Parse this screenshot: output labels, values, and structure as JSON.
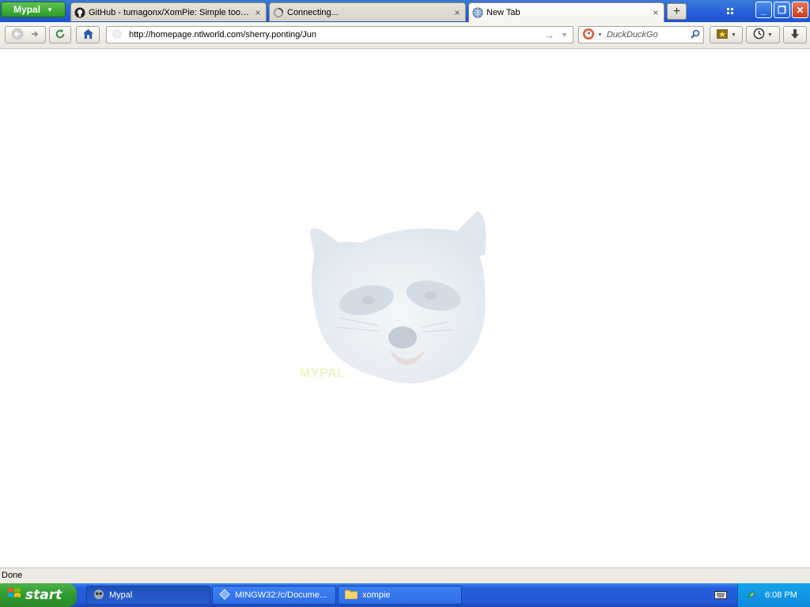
{
  "app_menu": {
    "label": "Mypal"
  },
  "tabs": [
    {
      "title": "GitHub - tumagonx/XomPie: Simple tools t...",
      "favicon": "github-icon",
      "close": "×"
    },
    {
      "title": "Connecting...",
      "favicon": "loading-icon",
      "close": "×"
    },
    {
      "title": "New Tab",
      "favicon": "globe-icon",
      "close": "×",
      "active": true
    }
  ],
  "new_tab": {
    "label": "+"
  },
  "window_controls": {
    "minimize": "_",
    "restore": "❐",
    "close": "✕"
  },
  "navigation": {
    "url": "http://homepage.ntlworld.com/sherry.ponting/Jun",
    "search_placeholder": "DuckDuckGo",
    "search_engine": "duckduckgo-icon"
  },
  "content": {
    "image": "raccoon-face",
    "watermark": "MYPAL"
  },
  "status": {
    "text": "Done"
  },
  "taskbar": {
    "start_label": "start",
    "tasks": [
      {
        "label": "Mypal",
        "icon": "mypal-icon",
        "active": true
      },
      {
        "label": "MINGW32:/c/Docume...",
        "icon": "mingw-icon"
      },
      {
        "label": "xompie",
        "icon": "folder-icon"
      }
    ],
    "clock": "6:08 PM"
  },
  "colors": {
    "tabstrip": "#245edb",
    "app_menu": "#2a9b27",
    "taskbar": "#245edb",
    "start": "#2f9a2d",
    "tray": "#0d8cdb"
  }
}
